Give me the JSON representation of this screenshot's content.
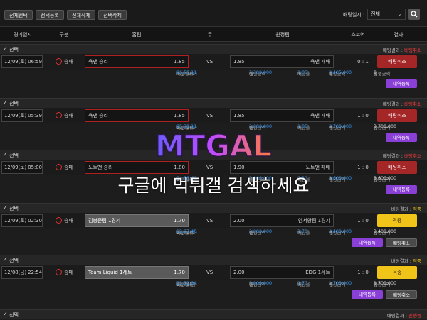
{
  "toolbar": {
    "buttons": [
      "전체선택",
      "선택등록",
      "전체삭제",
      "선택삭제"
    ],
    "date_filter_label": "배팅일시 :",
    "date_filter_value": "전체"
  },
  "table_headers": [
    "경기일시",
    "구분",
    "홈팀",
    "무",
    "원정팀",
    "스코어",
    "결과"
  ],
  "common": {
    "select_label": "선택",
    "vs": "VS",
    "type_label": "승패",
    "result_prefix": "배팅결과 :",
    "bet_time_label": "배팅일시",
    "bet_amount_label": "배팅금액",
    "odds_label": "배당율",
    "expected_label": "예상금액",
    "hit_label": "적중금액",
    "won_unit": "원",
    "times_unit": "배",
    "submit_button": "내역등록",
    "cancel_button": "배팅취소"
  },
  "bets": [
    {
      "date": "12/09(토) 06:59",
      "home": "욕맨 승리",
      "home_odds": "1.85",
      "away_odds": "1.85",
      "away": "욕맨 패배",
      "score": "0 : 1",
      "result_button": "배팅취소",
      "result_status": "배팅취소",
      "bet_date": "12/09(토)",
      "bet_time": "06:58:11",
      "amount": "1,300,000",
      "odds": "1.85",
      "expected": "2,405,000",
      "hit": "0",
      "buttons": [
        "내역등록"
      ]
    },
    {
      "date": "12/09(토) 05:39",
      "home": "욕맨 승리",
      "home_odds": "1.85",
      "away_odds": "1.85",
      "away": "욕맨 패배",
      "score": "1 : 0",
      "result_button": "배팅취소",
      "result_status": "배팅취소",
      "bet_date": "12/09(토)",
      "bet_time": "05:38:11",
      "amount": "2,000,000",
      "odds": "1.85",
      "expected": "3,700,000",
      "hit": "3,700,000",
      "buttons": [
        "내역등록"
      ]
    },
    {
      "date": "12/09(토) 05:00",
      "home": "도트맨 승리",
      "home_odds": "1.80",
      "away_odds": "1.90",
      "away": "도트맨 패배",
      "score": "1 : 0",
      "result_button": "배팅취소",
      "result_status": "배팅취소",
      "bet_date": "12/09(토)",
      "bet_time": "04:58:40",
      "amount": "2,000,000",
      "odds": "1.80",
      "expected": "3,600,000",
      "hit": "3,600,000",
      "buttons": [
        "내역등록"
      ]
    },
    {
      "date": "12/09(토) 02:30",
      "home": "김봉준팀 1경기",
      "home_odds": "1.70",
      "away_odds": "2.00",
      "away": "인서양팀 1경기",
      "score": "1 : 0",
      "result_button": "적중",
      "result_status": "적중",
      "bet_date": "12/09(토)",
      "bet_time": "02:27:48",
      "amount": "2,000,000",
      "odds": "1.70",
      "expected": "3,400,000",
      "hit": "3,400,000",
      "buttons": [
        "내역등록",
        "배팅취소"
      ]
    },
    {
      "date": "12/08(금) 22:54",
      "home": "Team Liquid 1세트",
      "home_odds": "1.70",
      "away_odds": "2.00",
      "away": "EDG 1세트",
      "score": "1 : 0",
      "result_button": "적중",
      "result_status": "적중",
      "bet_date": "12/08(금)",
      "bet_time": "22:32:04",
      "amount": "1,000,000",
      "odds": "1.70",
      "expected": "1,700,000",
      "hit": "1,700,000",
      "buttons": [
        "내역등록",
        "배팅취소"
      ]
    }
  ],
  "last_section": {
    "result_status": "진행중"
  },
  "watermark": {
    "logo": "MTGAL",
    "text": "구글에 먹튀갤 검색하세요"
  },
  "colors": {
    "cancel": "#a52626",
    "hit": "#f0c419",
    "purple": "#8a3fd6",
    "blue": "#3aa0ff"
  }
}
